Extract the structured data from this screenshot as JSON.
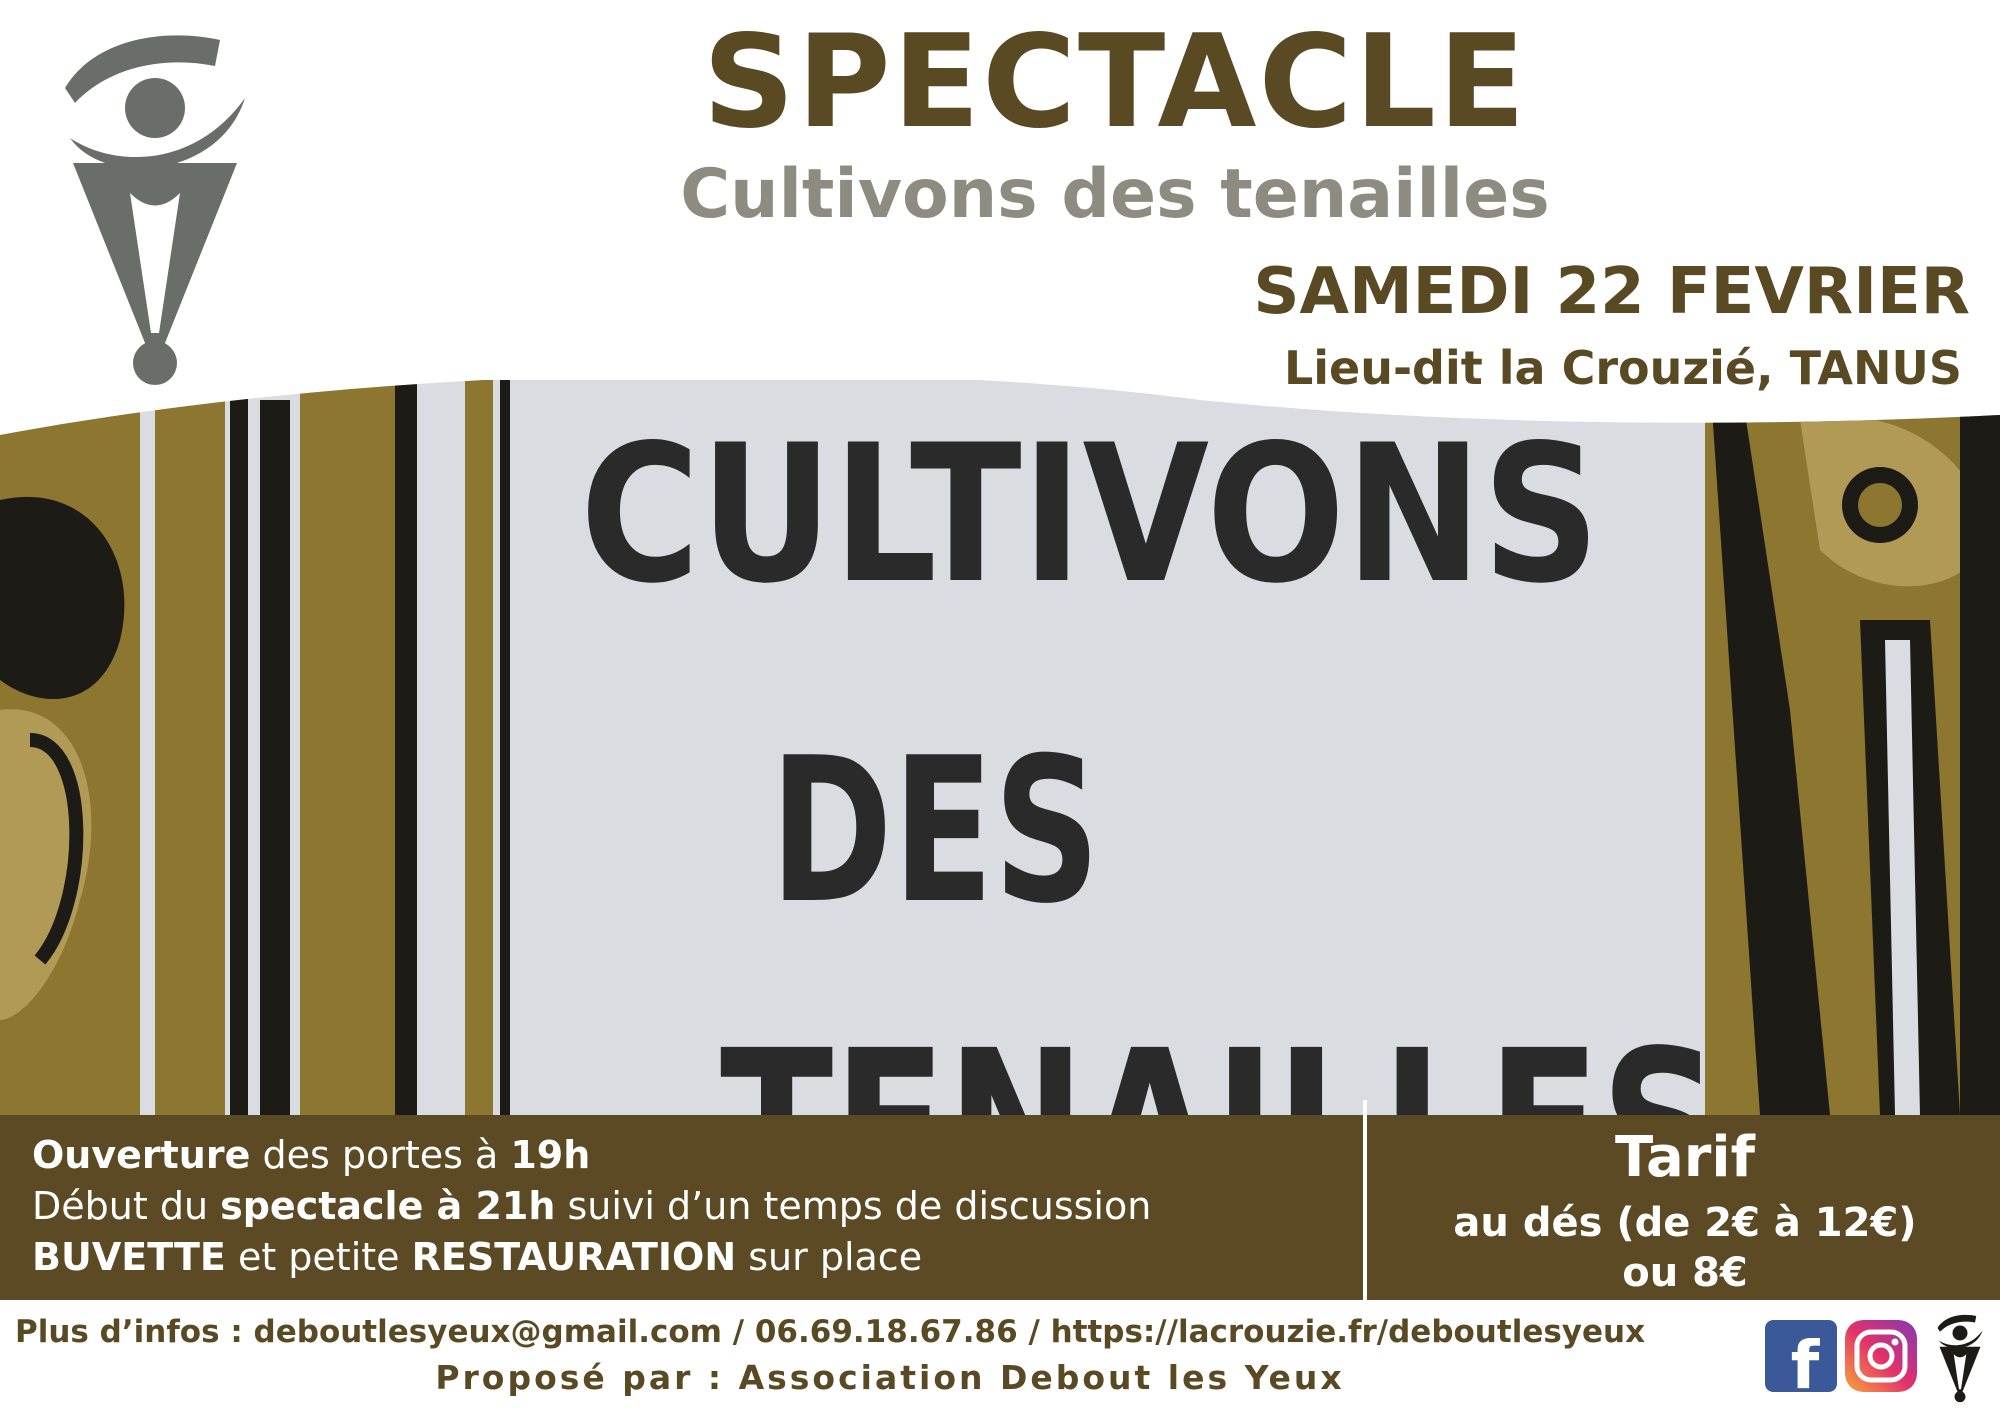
{
  "header": {
    "title": "SPECTACLE",
    "subtitle": "Cultivons des tenailles",
    "date": "SAMEDI 22 FEVRIER",
    "place": "Lieu-dit la Crouzié, TANUS"
  },
  "artwork": {
    "line1": "CULTIVONS",
    "line2": "DES",
    "line3": "TENAILLES"
  },
  "info": {
    "l1_b1": "Ouverture",
    "l1_t1": " des portes à ",
    "l1_b2": "19h",
    "l2_t1": "Début du ",
    "l2_b1": "spectacle à 21h",
    "l2_t2": " suivi d’un temps de discussion",
    "l3_b1": "BUVETTE",
    "l3_t1": " et petite ",
    "l3_b2": "RESTAURATION",
    "l3_t2": " sur place"
  },
  "tarif": {
    "title": "Tarif",
    "range": "au dés (de 2€ à 12€)",
    "alt": "ou 8€"
  },
  "footer": {
    "contact": "Plus d’infos : deboutlesyeux@gmail.com / 06.69.18.67.86 / https://lacrouzie.fr/deboutlesyeux",
    "proposer": "Proposé par : Association Debout les Yeux",
    "facebook_letter": "f"
  },
  "colors": {
    "brown": "#5b4a23",
    "gray": "#8e8c80",
    "ochre": "#8c7630",
    "paper": "#d9dce0",
    "logo_gray": "#6a6e68"
  }
}
